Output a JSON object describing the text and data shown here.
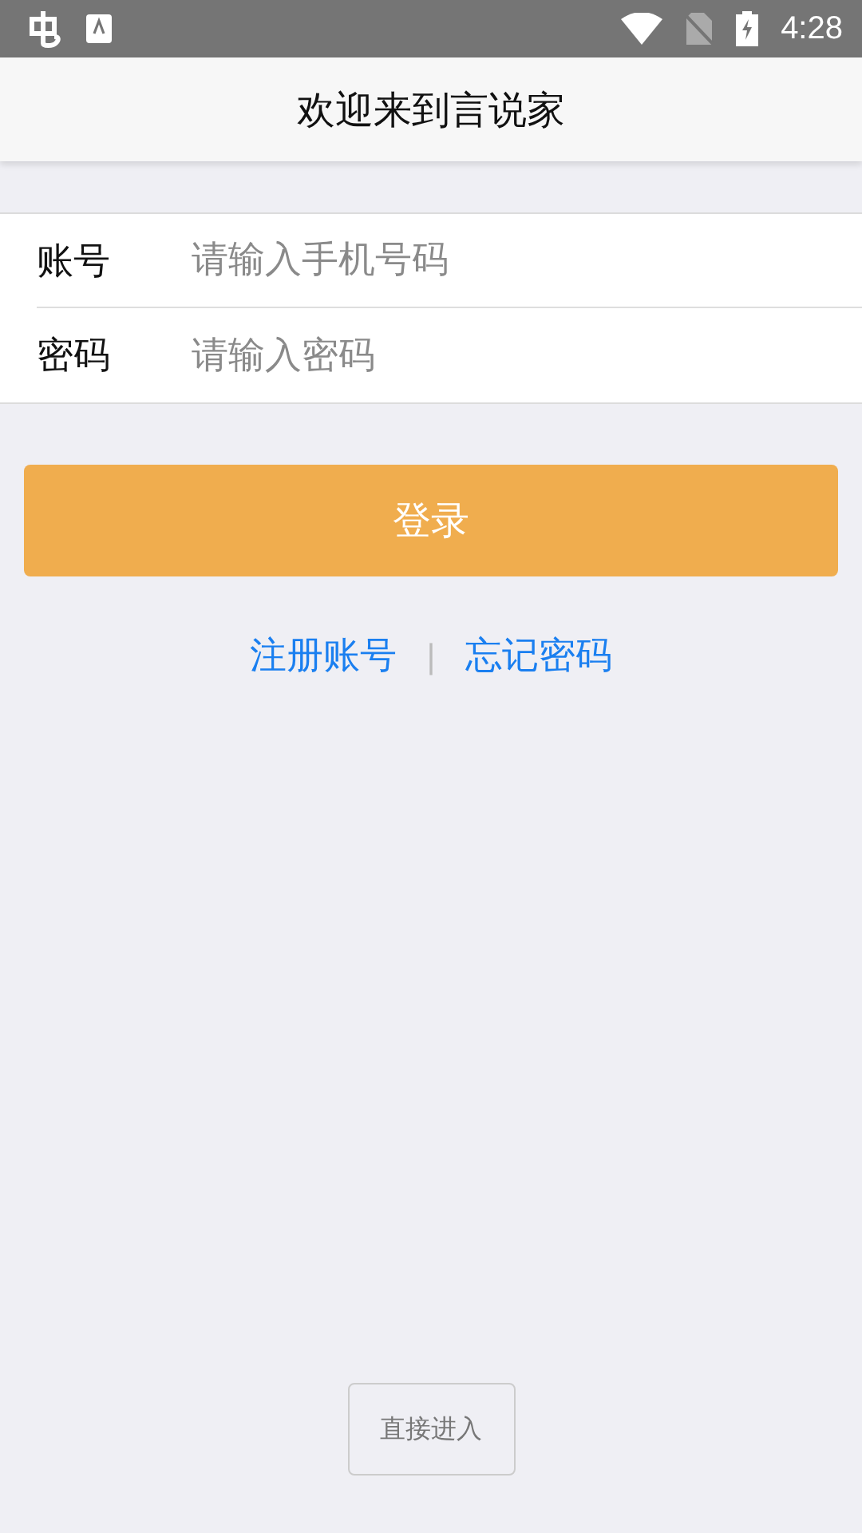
{
  "status_bar": {
    "time": "4:28"
  },
  "header": {
    "title": "欢迎来到言说家"
  },
  "fields": [
    {
      "label": "账号",
      "placeholder": "请输入手机号码"
    },
    {
      "label": "密码",
      "placeholder": "请输入密码"
    }
  ],
  "login_button": "登录",
  "links": [
    "注册账号",
    "忘记密码"
  ],
  "link_separator": "|",
  "skip_button": "直接进入"
}
